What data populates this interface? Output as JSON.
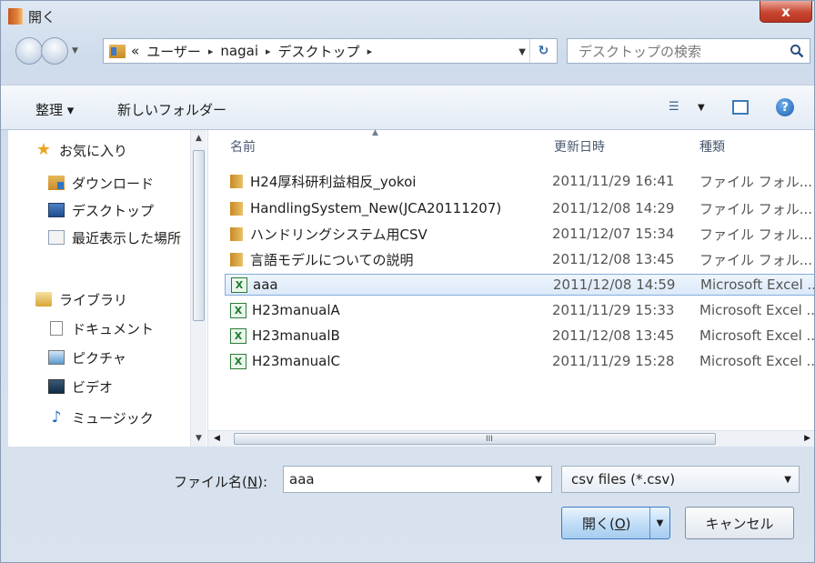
{
  "window": {
    "title": "開く",
    "close_label": "x"
  },
  "address": {
    "overflow": "«",
    "crumbs": [
      "ユーザー",
      "nagai",
      "デスクトップ"
    ],
    "search_placeholder": "デスクトップの検索"
  },
  "toolbar": {
    "organize_label": "整理 ▾",
    "new_folder_label": "新しいフォルダー",
    "view_icon": "view-options-icon",
    "help_label": "?"
  },
  "navpane": {
    "favorites": {
      "label": "お気に入り",
      "items": [
        "ダウンロード",
        "デスクトップ",
        "最近表示した場所"
      ]
    },
    "libraries": {
      "label": "ライブラリ",
      "items": [
        "ドキュメント",
        "ピクチャ",
        "ビデオ",
        "ミュージック"
      ]
    }
  },
  "filelist": {
    "columns": {
      "name": "名前",
      "date": "更新日時",
      "type": "種類"
    },
    "rows": [
      {
        "name": "H24厚科研利益相反_yokoi",
        "date": "2011/11/29 16:41",
        "type": "ファイル フォル...",
        "kind": "folder"
      },
      {
        "name": "HandlingSystem_New(JCA20111207)",
        "date": "2011/12/08 14:29",
        "type": "ファイル フォル...",
        "kind": "folder"
      },
      {
        "name": "ハンドリングシステム用CSV",
        "date": "2011/12/07 15:34",
        "type": "ファイル フォル...",
        "kind": "folder"
      },
      {
        "name": "言語モデルについての説明",
        "date": "2011/12/08 13:45",
        "type": "ファイル フォル...",
        "kind": "folder"
      },
      {
        "name": "aaa",
        "date": "2011/12/08 14:59",
        "type": "Microsoft Excel ...",
        "kind": "excel",
        "selected": true
      },
      {
        "name": "H23manualA",
        "date": "2011/11/29 15:33",
        "type": "Microsoft Excel ...",
        "kind": "excel"
      },
      {
        "name": "H23manualB",
        "date": "2011/12/08 13:45",
        "type": "Microsoft Excel ...",
        "kind": "excel"
      },
      {
        "name": "H23manualC",
        "date": "2011/11/29 15:28",
        "type": "Microsoft Excel ...",
        "kind": "excel"
      }
    ],
    "hscroll_grip": "III"
  },
  "bottom": {
    "filename_label_pre": "ファイル名(",
    "filename_label_key": "N",
    "filename_label_post": "):",
    "filename_value": "aaa",
    "filetype_value": "csv files (*.csv)",
    "open_label_pre": "開く(",
    "open_label_key": "O",
    "open_label_post": ")",
    "cancel_label": "キャンセル"
  }
}
